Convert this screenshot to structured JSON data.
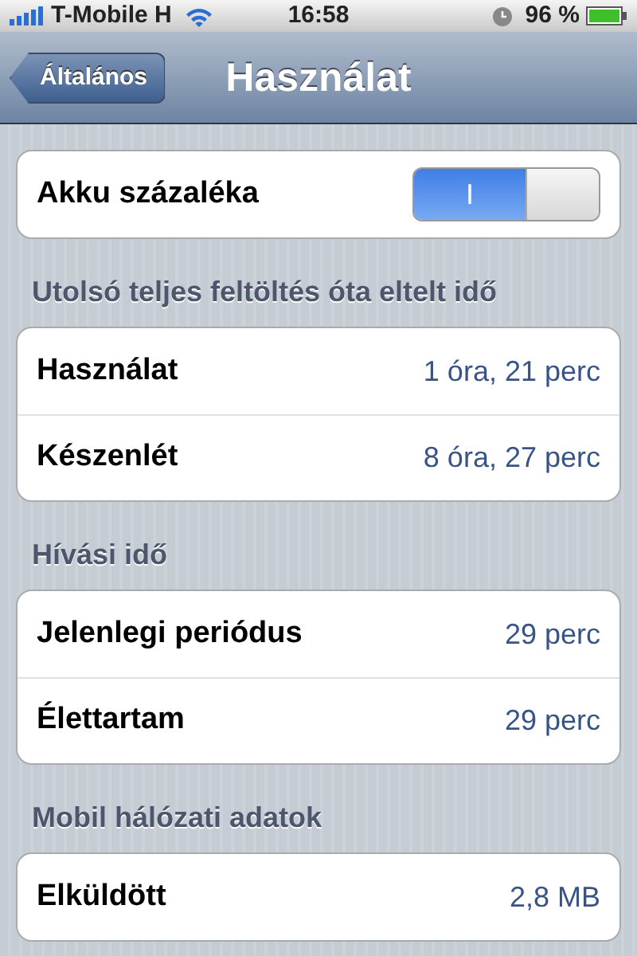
{
  "status_bar": {
    "carrier": "T-Mobile H",
    "time": "16:58",
    "battery": "96 %"
  },
  "nav": {
    "back": "Általános",
    "title": "Használat"
  },
  "sections": [
    {
      "rows": [
        {
          "kind": "switch",
          "label": "Akku százaléka",
          "on": true,
          "on_label": "I"
        }
      ]
    },
    {
      "header": "Utolsó teljes feltöltés óta eltelt idő",
      "rows": [
        {
          "kind": "value",
          "label": "Használat",
          "value": "1 óra, 21 perc"
        },
        {
          "kind": "value",
          "label": "Készenlét",
          "value": "8 óra, 27 perc"
        }
      ]
    },
    {
      "header": "Hívási idő",
      "rows": [
        {
          "kind": "value",
          "label": "Jelenlegi periódus",
          "value": "29 perc"
        },
        {
          "kind": "value",
          "label": "Élettartam",
          "value": "29 perc"
        }
      ]
    },
    {
      "header": "Mobil hálózati adatok",
      "rows": [
        {
          "kind": "value",
          "label": "Elküldött",
          "value": "2,8 MB"
        }
      ]
    }
  ]
}
